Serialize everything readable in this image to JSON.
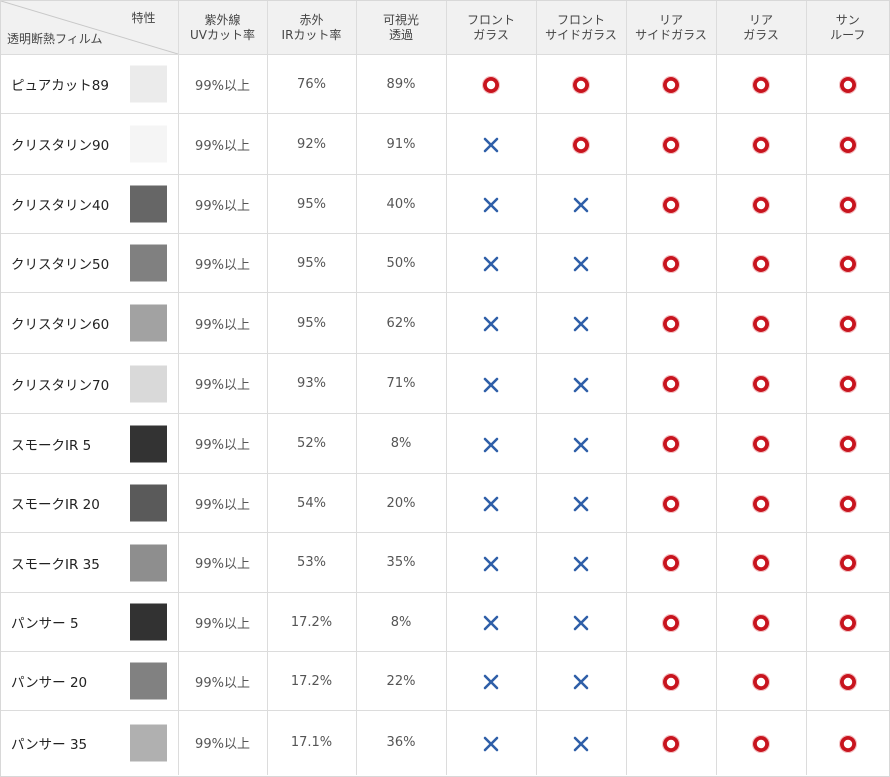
{
  "header": {
    "corner_top": "特性",
    "corner_bottom": "透明断熱フィルム",
    "columns": [
      [
        "紫外線",
        "UVカット率"
      ],
      [
        "赤外",
        "IRカット率"
      ],
      [
        "可視光",
        "透過"
      ],
      [
        "フロント",
        "ガラス"
      ],
      [
        "フロント",
        "サイドガラス"
      ],
      [
        "リア",
        "サイドガラス"
      ],
      [
        "リア",
        "ガラス"
      ],
      [
        "サン",
        "ルーフ"
      ]
    ]
  },
  "rows": [
    {
      "name": "ピュアカット89",
      "swatch": "#ebebeb",
      "uv": "99%以上",
      "ir": "76%",
      "vis": "89%",
      "marks": [
        "circle-icon",
        "circle-icon",
        "circle-icon",
        "circle-icon",
        "circle-icon"
      ]
    },
    {
      "name": "クリスタリン90",
      "swatch": "#f5f5f5",
      "uv": "99%以上",
      "ir": "92%",
      "vis": "91%",
      "marks": [
        "cross-icon",
        "circle-icon",
        "circle-icon",
        "circle-icon",
        "circle-icon"
      ]
    },
    {
      "name": "クリスタリン40",
      "swatch": "#666666",
      "uv": "99%以上",
      "ir": "95%",
      "vis": "40%",
      "marks": [
        "cross-icon",
        "cross-icon",
        "circle-icon",
        "circle-icon",
        "circle-icon"
      ]
    },
    {
      "name": "クリスタリン50",
      "swatch": "#808080",
      "uv": "99%以上",
      "ir": "95%",
      "vis": "50%",
      "marks": [
        "cross-icon",
        "cross-icon",
        "circle-icon",
        "circle-icon",
        "circle-icon"
      ]
    },
    {
      "name": "クリスタリン60",
      "swatch": "#a2a2a2",
      "uv": "99%以上",
      "ir": "95%",
      "vis": "62%",
      "marks": [
        "cross-icon",
        "cross-icon",
        "circle-icon",
        "circle-icon",
        "circle-icon"
      ]
    },
    {
      "name": "クリスタリン70",
      "swatch": "#d9d9d9",
      "uv": "99%以上",
      "ir": "93%",
      "vis": "71%",
      "marks": [
        "cross-icon",
        "cross-icon",
        "circle-icon",
        "circle-icon",
        "circle-icon"
      ]
    },
    {
      "name": "スモークIR 5",
      "swatch": "#333333",
      "uv": "99%以上",
      "ir": "52%",
      "vis": "8%",
      "marks": [
        "cross-icon",
        "cross-icon",
        "circle-icon",
        "circle-icon",
        "circle-icon"
      ]
    },
    {
      "name": "スモークIR 20",
      "swatch": "#5a5a5a",
      "uv": "99%以上",
      "ir": "54%",
      "vis": "20%",
      "marks": [
        "cross-icon",
        "cross-icon",
        "circle-icon",
        "circle-icon",
        "circle-icon"
      ]
    },
    {
      "name": "スモークIR 35",
      "swatch": "#8e8e8e",
      "uv": "99%以上",
      "ir": "53%",
      "vis": "35%",
      "marks": [
        "cross-icon",
        "cross-icon",
        "circle-icon",
        "circle-icon",
        "circle-icon"
      ]
    },
    {
      "name": "パンサー 5",
      "swatch": "#323232",
      "uv": "99%以上",
      "ir": "17.2%",
      "vis": "8%",
      "marks": [
        "cross-icon",
        "cross-icon",
        "circle-icon",
        "circle-icon",
        "circle-icon"
      ]
    },
    {
      "name": "パンサー 20",
      "swatch": "#818181",
      "uv": "99%以上",
      "ir": "17.2%",
      "vis": "22%",
      "marks": [
        "cross-icon",
        "cross-icon",
        "circle-icon",
        "circle-icon",
        "circle-icon"
      ]
    },
    {
      "name": "パンサー 35",
      "swatch": "#b0b0b0",
      "uv": "99%以上",
      "ir": "17.1%",
      "vis": "36%",
      "marks": [
        "cross-icon",
        "cross-icon",
        "circle-icon",
        "circle-icon",
        "circle-icon"
      ]
    }
  ],
  "colors": {
    "circle_outer": "#c8141e",
    "cross": "#2f5fa8",
    "header_bg": "#f1f1f1",
    "border": "#dcdcdc"
  }
}
